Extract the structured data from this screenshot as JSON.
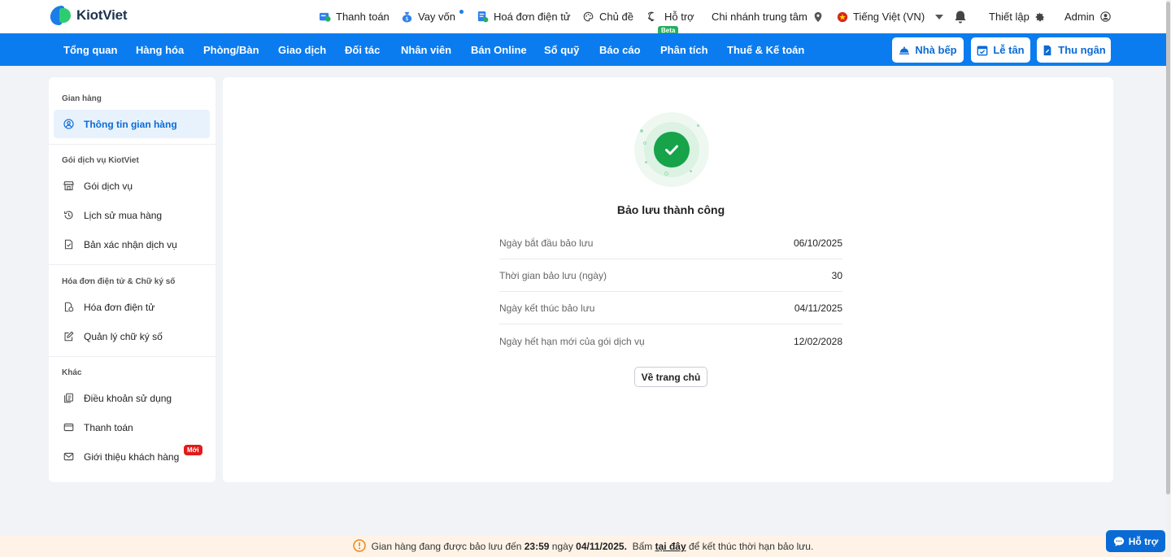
{
  "header": {
    "logo_text": "KiotViet",
    "items": {
      "payment": "Thanh toán",
      "loan": "Vay vốn",
      "einvoice": "Hoá đơn điện tử",
      "theme": "Chủ đề",
      "support": "Hỗ trợ",
      "support_badge": "Beta",
      "branch": "Chi nhánh trung tâm",
      "language": "Tiếng Việt (VN)",
      "settings": "Thiết lập",
      "user": "Admin"
    }
  },
  "nav": {
    "items": [
      "Tổng quan",
      "Hàng hóa",
      "Phòng/Bàn",
      "Giao dịch",
      "Đối tác",
      "Nhân viên",
      "Bán Online",
      "Sổ quỹ",
      "Báo cáo",
      "Phân tích",
      "Thuế & Kế toán"
    ],
    "buttons": {
      "kitchen": "Nhà bếp",
      "reception": "Lễ tân",
      "cashier": "Thu ngân"
    }
  },
  "sidebar": {
    "groups": {
      "store": "Gian hàng",
      "service": "Gói dịch vụ KiotViet",
      "invoice": "Hóa đơn điện tử & Chữ ký số",
      "other": "Khác"
    },
    "items": {
      "store_info": "Thông tin gian hàng",
      "service_package": "Gói dịch vụ",
      "purchase_history": "Lịch sử mua hàng",
      "service_confirm": "Bản xác nhận dịch vụ",
      "einvoice": "Hóa đơn điện tử",
      "signature": "Quản lý chữ ký số",
      "terms": "Điều khoản sử dụng",
      "payment": "Thanh toán",
      "referral": "Giới thiệu khách hàng",
      "referral_badge": "Mới"
    }
  },
  "main": {
    "title": "Bảo lưu thành công",
    "rows": [
      {
        "label": "Ngày bắt đầu bảo lưu",
        "value": "06/10/2025"
      },
      {
        "label": "Thời gian bảo lưu (ngày)",
        "value": "30"
      },
      {
        "label": "Ngày kết thúc bảo lưu",
        "value": "04/11/2025"
      },
      {
        "label": "Ngày hết hạn mới của gói dịch vụ",
        "value": "12/02/2028"
      }
    ],
    "home_button": "Về trang chủ"
  },
  "banner": {
    "prefix": "Gian hàng đang được bảo lưu đến",
    "time": "23:59",
    "mid": "ngày",
    "date": "04/11/2025.",
    "cta_prefix": "Bấm",
    "cta_link": "tại đây",
    "cta_suffix": "để kết thúc thời hạn bảo lưu."
  },
  "help_button": "Hỗ trợ",
  "colors": {
    "primary": "#0a7cf0",
    "success": "#16a34a",
    "badge_red": "#e21b1b",
    "banner_bg": "#fef3e6"
  }
}
